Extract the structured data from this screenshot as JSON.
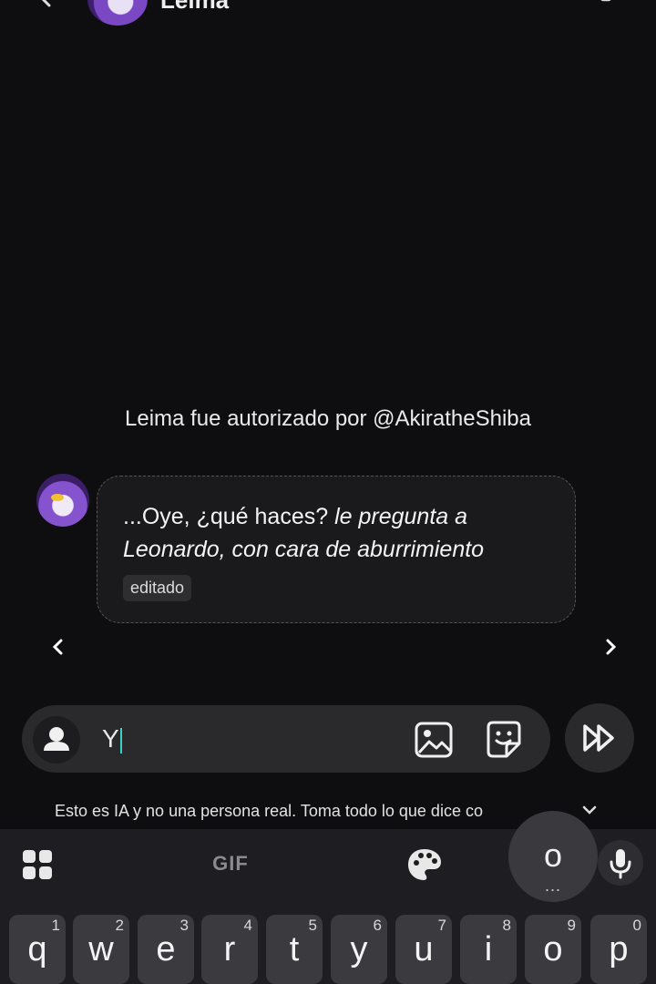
{
  "header": {
    "title": "Leima",
    "back_icon": "chevron-left-icon",
    "call_icon": "voice-call-icon",
    "menu_icon": "menu-icon"
  },
  "notice": "Leima fue autorizado por @AkiratheShiba",
  "message": {
    "text_plain": "...Oye, ¿qué haces? ",
    "text_italic": "le pregunta a Leonardo, con cara de aburrimiento",
    "edited_label": "editado"
  },
  "nav": {
    "prev": "‹",
    "next": "›"
  },
  "composer": {
    "value": "Y",
    "icons": [
      "persona-icon",
      "image-icon",
      "sticker-icon",
      "fast-forward-icon"
    ]
  },
  "disclaimer": "Esto es IA y no una persona real. Toma todo lo que dice co",
  "keyboard": {
    "gif_label": "GIF",
    "popup_char": "o",
    "popup_dots": "...",
    "keys": [
      {
        "ch": "q",
        "num": "1"
      },
      {
        "ch": "w",
        "num": "2"
      },
      {
        "ch": "e",
        "num": "3"
      },
      {
        "ch": "r",
        "num": "4"
      },
      {
        "ch": "t",
        "num": "5"
      },
      {
        "ch": "y",
        "num": "6"
      },
      {
        "ch": "u",
        "num": "7"
      },
      {
        "ch": "i",
        "num": "8"
      },
      {
        "ch": "o",
        "num": "9"
      },
      {
        "ch": "p",
        "num": "0"
      }
    ]
  },
  "colors": {
    "background": "#0e0e10",
    "bubble": "#1a1a1c",
    "input_bar": "#2a2a2d",
    "keyboard": "#1e1e22",
    "key": "#3a3a3f",
    "caret": "#3ad0c4"
  }
}
